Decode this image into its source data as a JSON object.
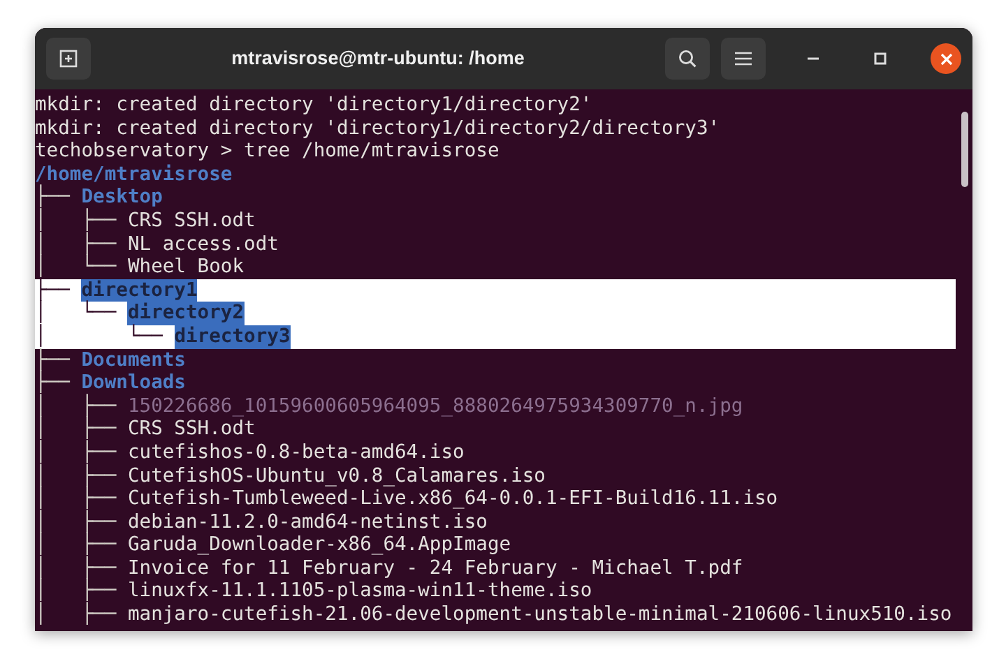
{
  "window": {
    "title": "mtravisrose@mtr-ubuntu: /home"
  },
  "lines": [
    {
      "text": "mkdir: created directory 'directory1/directory2'",
      "kind": "plain",
      "selected": false
    },
    {
      "text": "mkdir: created directory 'directory1/directory2/directory3'",
      "kind": "plain",
      "selected": false
    },
    {
      "text": "techobservatory > tree /home/mtravisrose",
      "kind": "plain",
      "selected": false
    },
    {
      "text": "/home/mtravisrose",
      "kind": "dir",
      "selected": false
    },
    {
      "prefix": "├── ",
      "text": "Desktop",
      "kind": "dir",
      "selected": false
    },
    {
      "prefix": "│   ├── ",
      "text": "CRS SSH.odt",
      "kind": "plain",
      "selected": false
    },
    {
      "prefix": "│   ├── ",
      "text": "NL access.odt",
      "kind": "plain",
      "selected": false
    },
    {
      "prefix": "│   └── ",
      "text": "Wheel Book",
      "kind": "plain",
      "selected": false
    },
    {
      "prefix": "├── ",
      "text": "directory1",
      "kind": "dir",
      "selected": true
    },
    {
      "prefix": "│   └── ",
      "text": "directory2",
      "kind": "dir",
      "selected": true
    },
    {
      "prefix": "│       └── ",
      "text": "directory3",
      "kind": "dir",
      "selected": true
    },
    {
      "prefix": "├── ",
      "text": "Documents",
      "kind": "dir",
      "selected": false
    },
    {
      "prefix": "├── ",
      "text": "Downloads",
      "kind": "dir",
      "selected": false
    },
    {
      "prefix": "│   ├── ",
      "text": "150226686_10159600605964095_8880264975934309770_n.jpg",
      "kind": "image",
      "selected": false
    },
    {
      "prefix": "│   ├── ",
      "text": "CRS SSH.odt",
      "kind": "plain",
      "selected": false
    },
    {
      "prefix": "│   ├── ",
      "text": "cutefishos-0.8-beta-amd64.iso",
      "kind": "plain",
      "selected": false
    },
    {
      "prefix": "│   ├── ",
      "text": "CutefishOS-Ubuntu_v0.8_Calamares.iso",
      "kind": "plain",
      "selected": false
    },
    {
      "prefix": "│   ├── ",
      "text": "Cutefish-Tumbleweed-Live.x86_64-0.0.1-EFI-Build16.11.iso",
      "kind": "plain",
      "selected": false
    },
    {
      "prefix": "│   ├── ",
      "text": "debian-11.2.0-amd64-netinst.iso",
      "kind": "plain",
      "selected": false
    },
    {
      "prefix": "│   ├── ",
      "text": "Garuda_Downloader-x86_64.AppImage",
      "kind": "plain",
      "selected": false
    },
    {
      "prefix": "│   ├── ",
      "text": "Invoice for 11 February - 24 February - Michael T.pdf",
      "kind": "plain",
      "selected": false
    },
    {
      "prefix": "│   ├── ",
      "text": "linuxfx-11.1.1105-plasma-win11-theme.iso",
      "kind": "plain",
      "selected": false
    },
    {
      "prefix": "│   ├── ",
      "text": "manjaro-cutefish-21.06-development-unstable-minimal-210606-linux510.iso",
      "kind": "plain",
      "selected": false
    }
  ]
}
